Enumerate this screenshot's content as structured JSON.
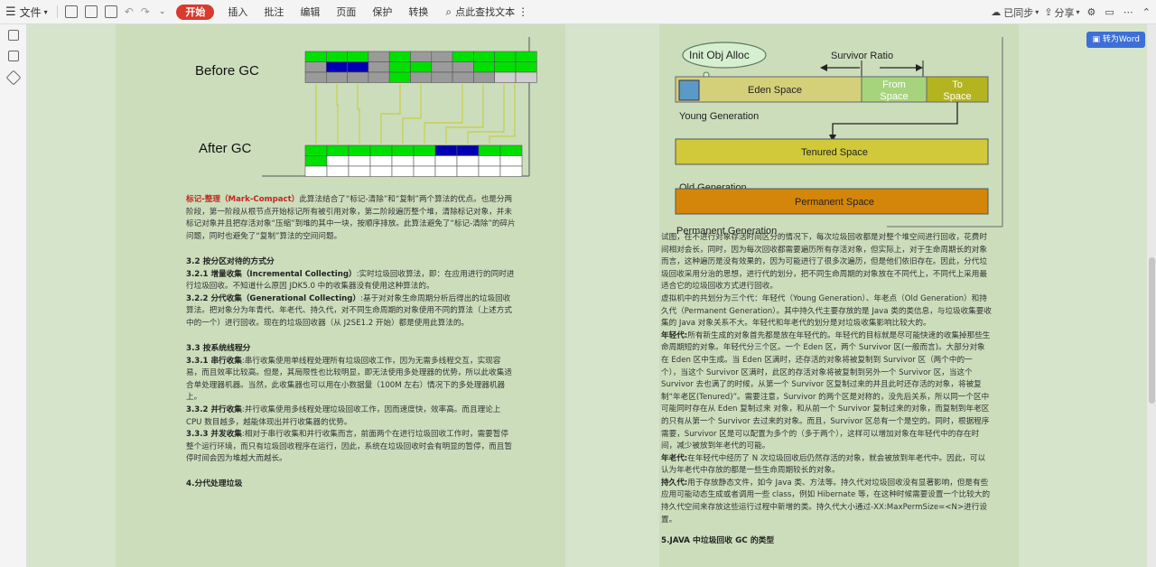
{
  "toolbar": {
    "file_label": "文件",
    "tabs": [
      "开始",
      "插入",
      "批注",
      "编辑",
      "页面",
      "保护",
      "转换"
    ],
    "search_label": "点此查找文本",
    "sync_label": "已同步",
    "share_label": "分享"
  },
  "convert_button": "转为Word",
  "gc_figure": {
    "before_label": "Before GC",
    "after_label": "After GC"
  },
  "gen_figure": {
    "init_label": "Init Obj Alloc",
    "ratio_label": "Survivor Ratio",
    "eden_label": "Eden Space",
    "from_label": "From Space",
    "to_label": "To Space",
    "young_label": "Young Generation",
    "tenured_label": "Tenured Space",
    "old_label": "Old Generation",
    "perm_label": "Permanent Space",
    "perm_gen_label": "Permanent Generation"
  },
  "left_page": {
    "mark_compact_title": "标记-整理（Mark-Compact）",
    "mark_compact_body": "此算法结合了“标记-清除”和“复制”两个算法的优点。也是分两阶段，第一阶段从根节点开始标记所有被引用对象，第二阶段遍历整个堆，清除标记对象，并未标记对象并且把存活对象“压缩”到堆的其中一块，按顺序排放。此算法避免了“标记-清除”的碎片问题，同时也避免了“复制”算法的空间问题。",
    "h_3_2": "3.2 按分区对待的方式分",
    "h_3_2_1": "3.2.1 增量收集（Incremental Collecting）",
    "p_3_2_1": "实时垃圾回收算法，即：在应用进行的同时进行垃圾回收。不知道什么原因 JDK5.0 中的收集器没有使用这种算法的。",
    "h_3_2_2": "3.2.2 分代收集（Generational Collecting）",
    "p_3_2_2": "基于对对象生命周期分析后得出的垃圾回收算法。把对象分为年青代、年老代、持久代，对不同生命周期的对象使用不同的算法（上述方式中的一个）进行回收。现在的垃圾回收器（从 J2SE1.2 开始）都是使用此算法的。",
    "h_3_3": "3.3 按系统线程分",
    "h_3_3_1": "3.3.1 串行收集",
    "p_3_3_1": "串行收集使用单线程处理所有垃圾回收工作，因为无需多线程交互，实现容易，而且效率比较高。但是，其局限性也比较明显，即无法使用多处理器的优势，所以此收集适合单处理器机器。当然，此收集器也可以用在小数据量（100M 左右）情况下的多处理器机器上。",
    "h_3_3_2": "3.3.2 并行收集",
    "p_3_3_2": "并行收集使用多线程处理垃圾回收工作，因而速度快，效率高。而且理论上 CPU 数目越多，越能体现出并行收集器的优势。",
    "h_3_3_3": "3.3.3 并发收集",
    "p_3_3_3": "相对于串行收集和并行收集而言，前面两个在进行垃圾回收工作时，需要暂停整个运行环境，而只有垃圾回收程序在运行，因此，系统在垃圾回收时会有明显的暂停，而且暂停时间会因为堆越大而越长。",
    "h_4": "4.分代处理垃圾"
  },
  "right_page": {
    "p1": "试图，在不进行对象存活时间区分的情况下，每次垃圾回收都是对整个堆空间进行回收，花费时间相对会长，同时，因为每次回收都需要遍历所有存活对象，但实际上，对于生命周期长的对象而言，这种遍历是没有效果的，因为可能进行了很多次遍历，但是他们依旧存在。因此，分代垃圾回收采用分治的思想，进行代的划分，把不同生命周期的对象放在不同代上，不同代上采用最适合它的垃圾回收方式进行回收。",
    "p2": "虚拟机中的共划分为三个代：年轻代（Young Generation）、年老点（Old Generation）和持久代（Permanent Generation）。其中持久代主要存放的是 Java 类的类信息，与垃圾收集要收集的 Java 对象关系不大。年轻代和年老代的划分是对垃圾收集影响比较大的。",
    "young_title": "年轻代:",
    "young_body": "所有新生成的对象首先都是放在年轻代的。年轻代的目标就是尽可能快速的收集掉那些生命周期短的对象。年轻代分三个区。一个 Eden 区，两个 Survivor 区(一般而言)。大部分对象在 Eden 区中生成。当 Eden 区满时，还存活的对象将被复制到 Survivor 区（两个中的一个），当这个 Survivor 区满时，此区的存活对象将被复制到另外一个 Survivor 区，当这个 Survivor 去也满了的时候，从第一个 Survivor 区复制过来的并且此时还存活的对象，将被复制“年老区(Tenured)”。需要注意，Survivor 的两个区是对称的，没先后关系，所以同一个区中可能同时存在从 Eden 复制过来 对象，和从前一个 Survivor 复制过来的对象，而复制到年老区的只有从第一个 Survivor 去过来的对象。而且，Survivor 区总有一个是空的。同时，根据程序需要，Survivor 区是可以配置为多个的（多于两个），这样可以增加对象在年轻代中的存在时间，减少被放到年老代的可能。",
    "old_title": "年老代:",
    "old_body": "在年轻代中经历了 N 次垃圾回收后仍然存活的对象，就会被放到年老代中。因此，可以认为年老代中存放的都是一些生命周期较长的对象。",
    "perm_title": "持久代:",
    "perm_body": "用于存放静态文件，如今 Java 类、方法等。持久代对垃圾回收没有显著影响，但是有些应用可能动态生成或者调用一些 class，例如 Hibernate 等，在这种时候需要设置一个比较大的持久代空间来存放这些运行过程中新增的类。持久代大小通过-XX:MaxPermSize=<N>进行设置。",
    "h_5": "5.JAVA 中垃圾回收 GC 的类型"
  }
}
